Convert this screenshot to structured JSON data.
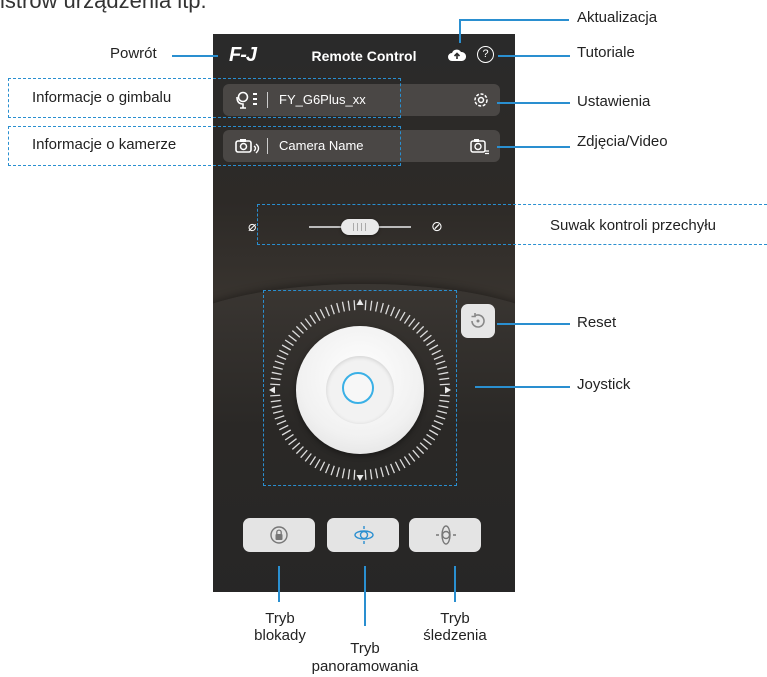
{
  "partial_header": "istrów urządzenia itp.",
  "app": {
    "logo": "F-J",
    "title": "Remote Control",
    "help_symbol": "?"
  },
  "gimbal_bar": {
    "name": "FY_G6Plus_xx",
    "icon": "gimbal-icon",
    "right_icon": "gear-icon"
  },
  "camera_bar": {
    "name": "Camera Name",
    "icon": "camera-bluetooth-icon",
    "right_icon": "photo-video-icon"
  },
  "tilt": {
    "left_symbol": "⌀",
    "right_symbol": "⊘",
    "value": 0.5
  },
  "modes": [
    {
      "icon": "lock-mode-icon",
      "selected": false
    },
    {
      "icon": "pan-mode-icon",
      "selected": true
    },
    {
      "icon": "tracking-mode-icon",
      "selected": false
    }
  ],
  "annotations": {
    "back": "Powrót",
    "update": "Aktualizacja",
    "tutorials": "Tutoriale",
    "gimbal_info": "Informacje o gimbalu",
    "settings": "Ustawienia",
    "camera_info": "Informacje o kamerze",
    "photo_video": "Zdjęcia/Video",
    "tilt_slider": "Suwak kontroli przechyłu",
    "reset": "Reset",
    "joystick": "Joystick",
    "lock_mode_line1": "Tryb",
    "lock_mode_line2": "blokady",
    "pan_mode_line1": "Tryb",
    "pan_mode_line2": "panoramowania",
    "track_mode_line1": "Tryb",
    "track_mode_line2": "śledzenia"
  },
  "colors": {
    "accent": "#2a8fd0",
    "joystick_ring": "#3ab0e6",
    "screen_bg": "#2a2a2a"
  }
}
